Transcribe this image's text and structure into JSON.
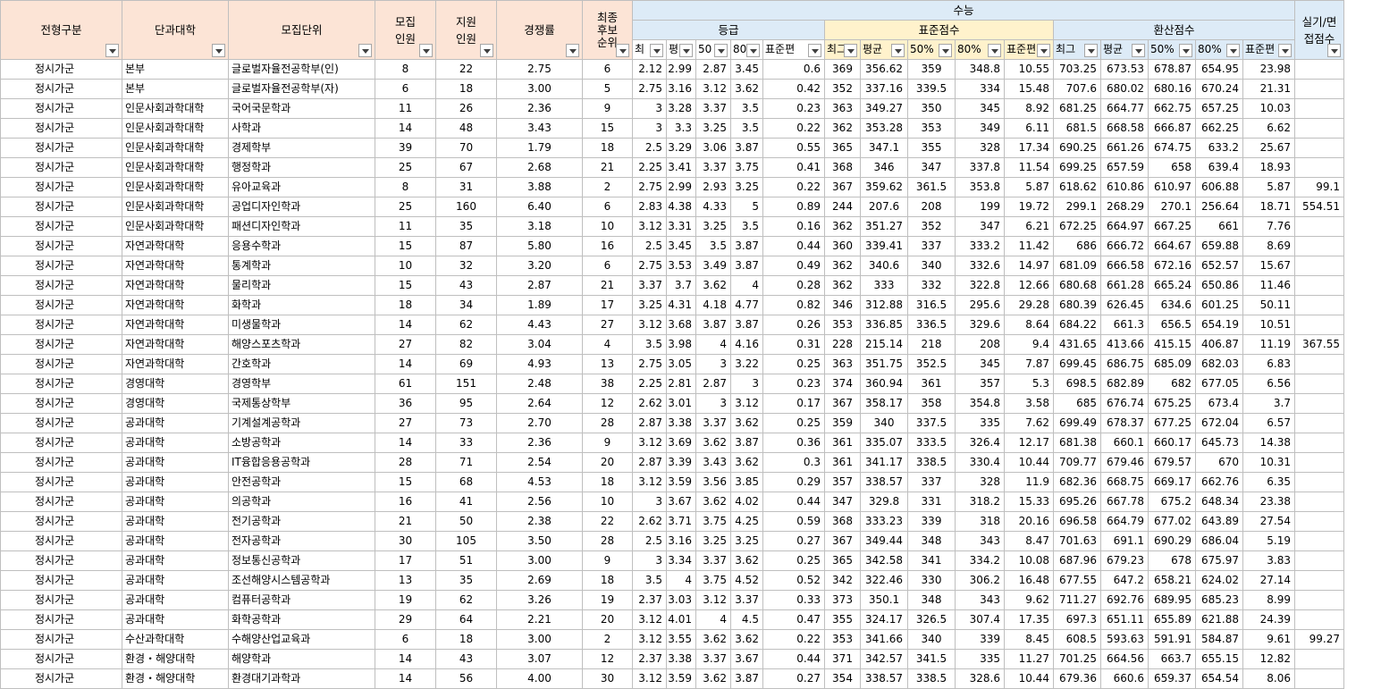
{
  "header": {
    "jeonhyung": "전형구분",
    "college": "단과대학",
    "unit": "모집단위",
    "recruit": [
      "모집",
      "인원"
    ],
    "applied": [
      "지원",
      "인원"
    ],
    "ratio": "경쟁률",
    "final": [
      "최종",
      "후보",
      "순위"
    ],
    "suneung": "수능",
    "grade_group": "등급",
    "std_group": "표준점수",
    "conv_group": "환산점수",
    "practical": [
      "실기/면",
      "접점수"
    ],
    "grade_sub": [
      "최",
      "평",
      "50",
      "80",
      "표준편"
    ],
    "std_sub": [
      "최그",
      "평균",
      "50%",
      "80%",
      "표준편"
    ],
    "conv_sub": [
      "최그",
      "평균",
      "50%",
      "80%",
      "표준편"
    ]
  },
  "rows": [
    [
      "정시가군",
      "본부",
      "글로벌자율전공학부(인)",
      "8",
      "22",
      "2.75",
      "6",
      "2.12",
      "2.99",
      "2.87",
      "3.45",
      "0.6",
      "369",
      "356.62",
      "359",
      "348.8",
      "10.55",
      "703.25",
      "673.53",
      "678.87",
      "654.95",
      "23.98",
      ""
    ],
    [
      "정시가군",
      "본부",
      "글로벌자율전공학부(자)",
      "6",
      "18",
      "3.00",
      "5",
      "2.75",
      "3.16",
      "3.12",
      "3.62",
      "0.42",
      "352",
      "337.16",
      "339.5",
      "334",
      "15.48",
      "707.6",
      "680.02",
      "680.16",
      "670.24",
      "21.31",
      ""
    ],
    [
      "정시가군",
      "인문사회과학대학",
      "국어국문학과",
      "11",
      "26",
      "2.36",
      "9",
      "3",
      "3.28",
      "3.37",
      "3.5",
      "0.23",
      "363",
      "349.27",
      "350",
      "345",
      "8.92",
      "681.25",
      "664.77",
      "662.75",
      "657.25",
      "10.03",
      ""
    ],
    [
      "정시가군",
      "인문사회과학대학",
      "사학과",
      "14",
      "48",
      "3.43",
      "15",
      "3",
      "3.3",
      "3.25",
      "3.5",
      "0.22",
      "362",
      "353.28",
      "353",
      "349",
      "6.11",
      "681.5",
      "668.58",
      "666.87",
      "662.25",
      "6.62",
      ""
    ],
    [
      "정시가군",
      "인문사회과학대학",
      "경제학부",
      "39",
      "70",
      "1.79",
      "18",
      "2.5",
      "3.29",
      "3.06",
      "3.87",
      "0.55",
      "365",
      "347.1",
      "355",
      "328",
      "17.34",
      "690.25",
      "661.26",
      "674.75",
      "633.2",
      "25.67",
      ""
    ],
    [
      "정시가군",
      "인문사회과학대학",
      "행정학과",
      "25",
      "67",
      "2.68",
      "21",
      "2.25",
      "3.41",
      "3.37",
      "3.75",
      "0.41",
      "368",
      "346",
      "347",
      "337.8",
      "11.54",
      "699.25",
      "657.59",
      "658",
      "639.4",
      "18.93",
      ""
    ],
    [
      "정시가군",
      "인문사회과학대학",
      "유아교육과",
      "8",
      "31",
      "3.88",
      "2",
      "2.75",
      "2.99",
      "2.93",
      "3.25",
      "0.22",
      "367",
      "359.62",
      "361.5",
      "353.8",
      "5.87",
      "618.62",
      "610.86",
      "610.97",
      "606.88",
      "5.87",
      "99.1"
    ],
    [
      "정시가군",
      "인문사회과학대학",
      "공업디자인학과",
      "25",
      "160",
      "6.40",
      "6",
      "2.83",
      "4.38",
      "4.33",
      "5",
      "0.89",
      "244",
      "207.6",
      "208",
      "199",
      "19.72",
      "299.1",
      "268.29",
      "270.1",
      "256.64",
      "18.71",
      "554.51"
    ],
    [
      "정시가군",
      "인문사회과학대학",
      "패션디자인학과",
      "11",
      "35",
      "3.18",
      "10",
      "3.12",
      "3.31",
      "3.25",
      "3.5",
      "0.16",
      "362",
      "351.27",
      "352",
      "347",
      "6.21",
      "672.25",
      "664.97",
      "667.25",
      "661",
      "7.76",
      ""
    ],
    [
      "정시가군",
      "자연과학대학",
      "응용수학과",
      "15",
      "87",
      "5.80",
      "16",
      "2.5",
      "3.45",
      "3.5",
      "3.87",
      "0.44",
      "360",
      "339.41",
      "337",
      "333.2",
      "11.42",
      "686",
      "666.72",
      "664.67",
      "659.88",
      "8.69",
      ""
    ],
    [
      "정시가군",
      "자연과학대학",
      "통계학과",
      "10",
      "32",
      "3.20",
      "6",
      "2.75",
      "3.53",
      "3.49",
      "3.87",
      "0.49",
      "362",
      "340.6",
      "340",
      "332.6",
      "14.97",
      "681.09",
      "666.58",
      "672.16",
      "652.57",
      "15.67",
      ""
    ],
    [
      "정시가군",
      "자연과학대학",
      "물리학과",
      "15",
      "43",
      "2.87",
      "21",
      "3.37",
      "3.7",
      "3.62",
      "4",
      "0.28",
      "362",
      "333",
      "332",
      "322.8",
      "12.66",
      "680.68",
      "661.28",
      "665.24",
      "650.86",
      "11.46",
      ""
    ],
    [
      "정시가군",
      "자연과학대학",
      "화학과",
      "18",
      "34",
      "1.89",
      "17",
      "3.25",
      "4.31",
      "4.18",
      "4.77",
      "0.82",
      "346",
      "312.88",
      "316.5",
      "295.6",
      "29.28",
      "680.39",
      "626.45",
      "634.6",
      "601.25",
      "50.11",
      ""
    ],
    [
      "정시가군",
      "자연과학대학",
      "미생물학과",
      "14",
      "62",
      "4.43",
      "27",
      "3.12",
      "3.68",
      "3.87",
      "3.87",
      "0.26",
      "353",
      "336.85",
      "336.5",
      "329.6",
      "8.64",
      "684.22",
      "661.3",
      "656.5",
      "654.19",
      "10.51",
      ""
    ],
    [
      "정시가군",
      "자연과학대학",
      "해양스포츠학과",
      "27",
      "82",
      "3.04",
      "4",
      "3.5",
      "3.98",
      "4",
      "4.16",
      "0.31",
      "228",
      "215.14",
      "218",
      "208",
      "9.4",
      "431.65",
      "413.66",
      "415.15",
      "406.87",
      "11.19",
      "367.55"
    ],
    [
      "정시가군",
      "자연과학대학",
      "간호학과",
      "14",
      "69",
      "4.93",
      "13",
      "2.75",
      "3.05",
      "3",
      "3.22",
      "0.25",
      "363",
      "351.75",
      "352.5",
      "345",
      "7.87",
      "699.45",
      "686.75",
      "685.09",
      "682.03",
      "6.83",
      ""
    ],
    [
      "정시가군",
      "경영대학",
      "경영학부",
      "61",
      "151",
      "2.48",
      "38",
      "2.25",
      "2.81",
      "2.87",
      "3",
      "0.23",
      "374",
      "360.94",
      "361",
      "357",
      "5.3",
      "698.5",
      "682.89",
      "682",
      "677.05",
      "6.56",
      ""
    ],
    [
      "정시가군",
      "경영대학",
      "국제통상학부",
      "36",
      "95",
      "2.64",
      "12",
      "2.62",
      "3.01",
      "3",
      "3.12",
      "0.17",
      "367",
      "358.17",
      "358",
      "354.8",
      "3.58",
      "685",
      "676.74",
      "675.25",
      "673.4",
      "3.7",
      ""
    ],
    [
      "정시가군",
      "공과대학",
      "기계설계공학과",
      "27",
      "73",
      "2.70",
      "28",
      "2.87",
      "3.38",
      "3.37",
      "3.62",
      "0.25",
      "359",
      "340",
      "337.5",
      "335",
      "7.62",
      "699.49",
      "678.37",
      "677.25",
      "672.04",
      "6.57",
      ""
    ],
    [
      "정시가군",
      "공과대학",
      "소방공학과",
      "14",
      "33",
      "2.36",
      "9",
      "3.12",
      "3.69",
      "3.62",
      "3.87",
      "0.36",
      "361",
      "335.07",
      "333.5",
      "326.4",
      "12.17",
      "681.38",
      "660.1",
      "660.17",
      "645.73",
      "14.38",
      ""
    ],
    [
      "정시가군",
      "공과대학",
      "IT융합응용공학과",
      "28",
      "71",
      "2.54",
      "20",
      "2.87",
      "3.39",
      "3.43",
      "3.62",
      "0.3",
      "361",
      "341.17",
      "338.5",
      "330.4",
      "10.44",
      "709.77",
      "679.46",
      "679.57",
      "670",
      "10.31",
      ""
    ],
    [
      "정시가군",
      "공과대학",
      "안전공학과",
      "15",
      "68",
      "4.53",
      "18",
      "3.12",
      "3.59",
      "3.56",
      "3.85",
      "0.29",
      "357",
      "338.57",
      "337",
      "328",
      "11.9",
      "682.36",
      "668.75",
      "669.17",
      "662.76",
      "6.35",
      ""
    ],
    [
      "정시가군",
      "공과대학",
      "의공학과",
      "16",
      "41",
      "2.56",
      "10",
      "3",
      "3.67",
      "3.62",
      "4.02",
      "0.44",
      "347",
      "329.8",
      "331",
      "318.2",
      "15.33",
      "695.26",
      "667.78",
      "675.2",
      "648.34",
      "23.38",
      ""
    ],
    [
      "정시가군",
      "공과대학",
      "전기공학과",
      "21",
      "50",
      "2.38",
      "22",
      "2.62",
      "3.71",
      "3.75",
      "4.25",
      "0.59",
      "368",
      "333.23",
      "339",
      "318",
      "20.16",
      "696.58",
      "664.79",
      "677.02",
      "643.89",
      "27.54",
      ""
    ],
    [
      "정시가군",
      "공과대학",
      "전자공학과",
      "30",
      "105",
      "3.50",
      "28",
      "2.5",
      "3.16",
      "3.25",
      "3.25",
      "0.27",
      "367",
      "349.44",
      "348",
      "343",
      "8.47",
      "701.63",
      "691.1",
      "690.29",
      "686.04",
      "5.19",
      ""
    ],
    [
      "정시가군",
      "공과대학",
      "정보통신공학과",
      "17",
      "51",
      "3.00",
      "9",
      "3",
      "3.34",
      "3.37",
      "3.62",
      "0.25",
      "365",
      "342.58",
      "341",
      "334.2",
      "10.08",
      "687.96",
      "679.23",
      "678",
      "675.97",
      "3.83",
      ""
    ],
    [
      "정시가군",
      "공과대학",
      "조선해양시스템공학과",
      "13",
      "35",
      "2.69",
      "18",
      "3.5",
      "4",
      "3.75",
      "4.52",
      "0.52",
      "342",
      "322.46",
      "330",
      "306.2",
      "16.48",
      "677.55",
      "647.2",
      "658.21",
      "624.02",
      "27.14",
      ""
    ],
    [
      "정시가군",
      "공과대학",
      "컴퓨터공학과",
      "19",
      "62",
      "3.26",
      "19",
      "2.37",
      "3.03",
      "3.12",
      "3.37",
      "0.33",
      "373",
      "350.1",
      "348",
      "343",
      "9.62",
      "711.27",
      "692.76",
      "689.95",
      "685.23",
      "8.99",
      ""
    ],
    [
      "정시가군",
      "공과대학",
      "화학공학과",
      "29",
      "64",
      "2.21",
      "20",
      "3.12",
      "4.01",
      "4",
      "4.5",
      "0.47",
      "355",
      "324.17",
      "326.5",
      "307.4",
      "17.35",
      "697.3",
      "651.11",
      "655.89",
      "621.88",
      "24.39",
      ""
    ],
    [
      "정시가군",
      "수산과학대학",
      "수해양산업교육과",
      "6",
      "18",
      "3.00",
      "2",
      "3.12",
      "3.55",
      "3.62",
      "3.62",
      "0.22",
      "353",
      "341.66",
      "340",
      "339",
      "8.45",
      "608.5",
      "593.63",
      "591.91",
      "584.87",
      "9.61",
      "99.27"
    ],
    [
      "정시가군",
      "환경・해양대학",
      "해양학과",
      "14",
      "43",
      "3.07",
      "12",
      "2.37",
      "3.38",
      "3.37",
      "3.67",
      "0.44",
      "371",
      "342.57",
      "341.5",
      "335",
      "11.27",
      "701.25",
      "664.56",
      "663.7",
      "655.15",
      "12.82",
      ""
    ],
    [
      "정시가군",
      "환경・해양대학",
      "환경대기과학과",
      "14",
      "56",
      "4.00",
      "30",
      "3.12",
      "3.59",
      "3.62",
      "3.87",
      "0.27",
      "354",
      "338.57",
      "338.5",
      "328.6",
      "10.44",
      "679.36",
      "660.6",
      "659.37",
      "654.54",
      "8.06",
      ""
    ]
  ]
}
